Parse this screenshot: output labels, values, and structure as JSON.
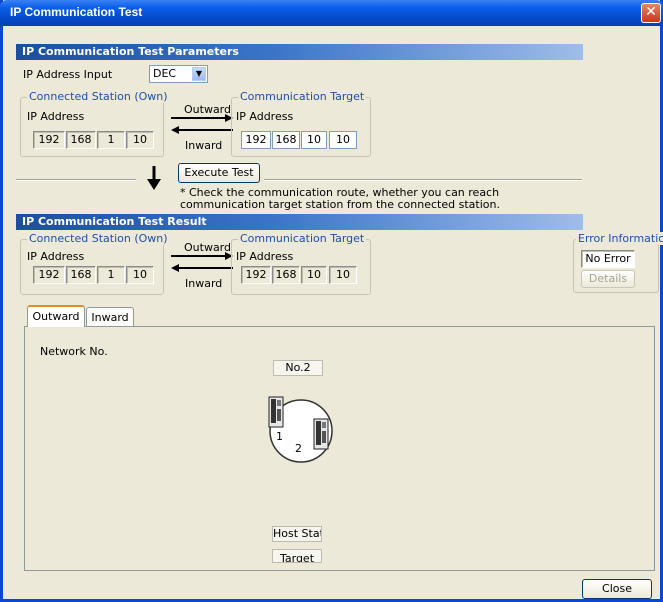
{
  "window": {
    "title": "IP Communication Test",
    "close_glyph": "✕"
  },
  "params": {
    "header": "IP Communication Test Parameters",
    "ip_input_label": "IP Address Input",
    "ip_input_value": "DEC",
    "own": {
      "title": "Connected Station (Own)",
      "ip_label": "IP Address",
      "octets": [
        "192",
        "168",
        "1",
        "10"
      ]
    },
    "target": {
      "title": "Communication Target",
      "ip_label": "IP Address",
      "octets": [
        "192",
        "168",
        "10",
        "10"
      ]
    },
    "outward": "Outward",
    "inward": "Inward"
  },
  "execute": {
    "button": "Execute Test",
    "note_line1": "* Check the communication route, whether you can reach",
    "note_line2": "communication target station from the connected station."
  },
  "result": {
    "header": "IP Communication Test Result",
    "own": {
      "title": "Connected Station (Own)",
      "ip_label": "IP Address",
      "octets": [
        "192",
        "168",
        "1",
        "10"
      ]
    },
    "target": {
      "title": "Communication Target",
      "ip_label": "IP Address",
      "octets": [
        "192",
        "168",
        "10",
        "10"
      ]
    },
    "outward": "Outward",
    "inward": "Inward",
    "error": {
      "title": "Error Information",
      "value": "No Error",
      "details_button": "Details"
    }
  },
  "tabs": [
    "Outward",
    "Inward"
  ],
  "diagram": {
    "network_label": "Network No.",
    "network_number": "No.2",
    "station1": "1",
    "station2": "2",
    "host_label": "Host Statio",
    "target_label": "Target"
  },
  "footer": {
    "close_button": "Close"
  }
}
